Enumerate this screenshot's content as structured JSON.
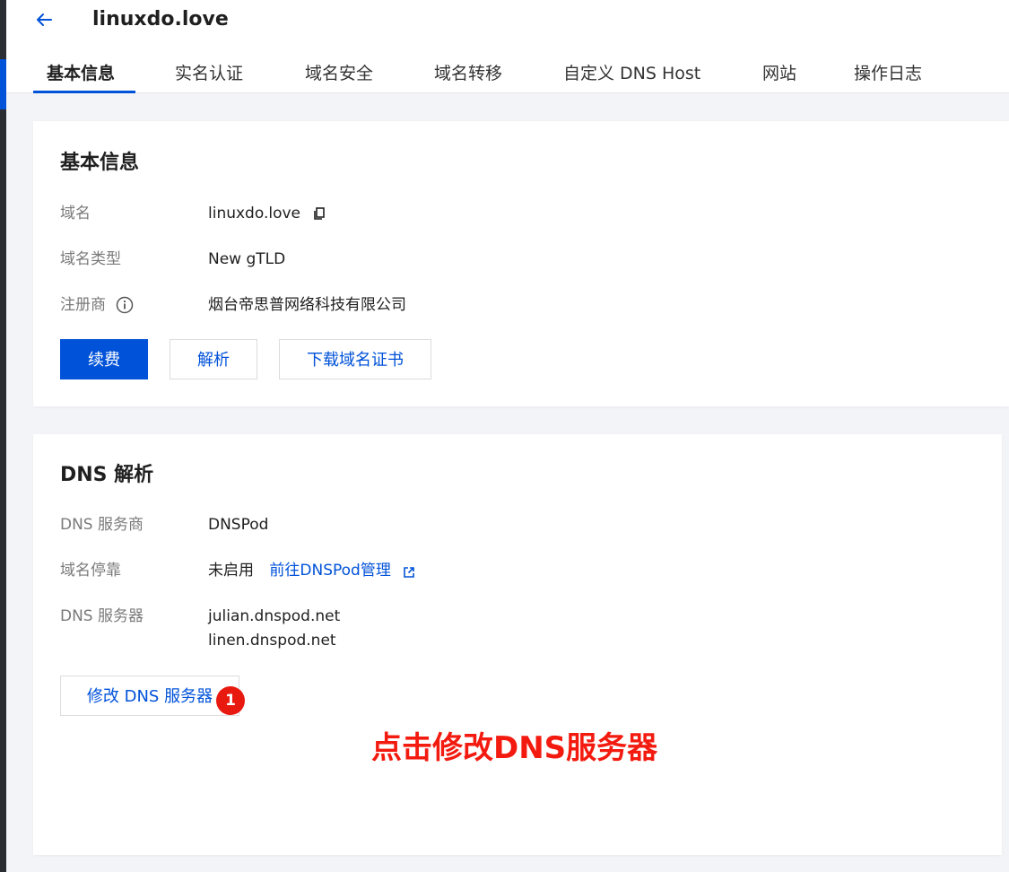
{
  "header": {
    "title": "linuxdo.love",
    "back_icon": "arrow-left-icon"
  },
  "tabs": [
    {
      "label": "基本信息",
      "active": true
    },
    {
      "label": "实名认证"
    },
    {
      "label": "域名安全"
    },
    {
      "label": "域名转移"
    },
    {
      "label": "自定义 DNS Host"
    },
    {
      "label": "网站"
    },
    {
      "label": "操作日志"
    }
  ],
  "basic_info": {
    "title": "基本信息",
    "rows": [
      {
        "label": "域名",
        "value": "linuxdo.love"
      },
      {
        "label": "域名类型",
        "value": "New gTLD"
      },
      {
        "label": "注册商",
        "value": "烟台帝思普网络科技有限公司"
      }
    ],
    "buttons": {
      "renew": "续费",
      "resolve": "解析",
      "download_cert": "下载域名证书"
    }
  },
  "dns": {
    "title": "DNS 解析",
    "rows": [
      {
        "label": "DNS 服务商",
        "value": "DNSPod"
      },
      {
        "label": "域名停靠",
        "value": "未启用",
        "link": "前往DNSPod管理"
      },
      {
        "label": "DNS 服务器",
        "values": [
          "julian.dnspod.net",
          "linen.dnspod.net"
        ]
      }
    ],
    "modify_button": "修改 DNS 服务器"
  },
  "annotation": {
    "marker": "1",
    "text": "点击修改DNS服务器",
    "color": "#f31b0f"
  },
  "colors": {
    "primary": "#0052d9",
    "background": "#f3f4f7"
  }
}
